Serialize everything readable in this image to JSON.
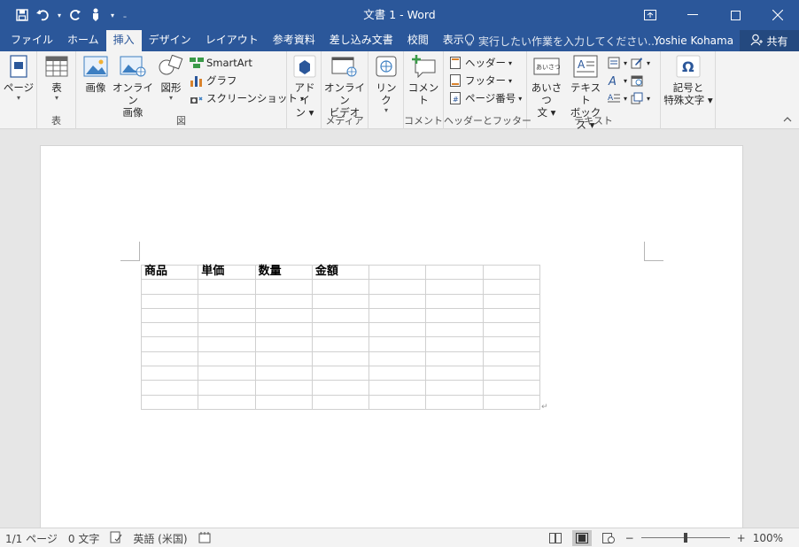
{
  "titlebar": {
    "title": "文書 1 - Word",
    "qat": [
      {
        "name": "save-icon"
      },
      {
        "name": "undo-icon"
      },
      {
        "name": "redo-icon"
      },
      {
        "name": "touch-mode-icon"
      }
    ]
  },
  "tabs": [
    "ファイル",
    "ホーム",
    "挿入",
    "デザイン",
    "レイアウト",
    "参考資料",
    "差し込み文書",
    "校閲",
    "表示"
  ],
  "active_tab": "挿入",
  "tellme": "実行したい作業を入力してください...",
  "user": "Yoshie Kohama",
  "share": "共有",
  "ribbon": {
    "groups": {
      "table": "表",
      "illustrations": "図",
      "media": "メディア",
      "comments": "コメント",
      "header_footer": "ヘッダーとフッター",
      "text": "テキスト"
    },
    "page": "ページ",
    "table": "表",
    "picture": "画像",
    "online_picture": [
      "オンライン",
      "画像"
    ],
    "shapes": "図形",
    "smartart": "SmartArt",
    "chart": "グラフ",
    "screenshot": "スクリーンショット",
    "addin": [
      "アドイ",
      "ン"
    ],
    "online_video": [
      "オンライン",
      "ビデオ"
    ],
    "link": "リンク",
    "comment": "コメント",
    "header": "ヘッダー",
    "footer": "フッター",
    "page_number": "ページ番号",
    "greeting": [
      "あいさつ",
      "文"
    ],
    "greeting_icon_text": "あいさつ",
    "textbox": [
      "テキスト",
      "ボックス"
    ],
    "symbols": [
      "記号と",
      "特殊文字"
    ]
  },
  "table": {
    "rows": [
      [
        "商品",
        "単価",
        "数量",
        "金額",
        "",
        "",
        ""
      ],
      [
        "",
        "",
        "",
        "",
        "",
        "",
        ""
      ],
      [
        "",
        "",
        "",
        "",
        "",
        "",
        ""
      ],
      [
        "",
        "",
        "",
        "",
        "",
        "",
        ""
      ],
      [
        "",
        "",
        "",
        "",
        "",
        "",
        ""
      ],
      [
        "",
        "",
        "",
        "",
        "",
        "",
        ""
      ],
      [
        "",
        "",
        "",
        "",
        "",
        "",
        ""
      ],
      [
        "",
        "",
        "",
        "",
        "",
        "",
        ""
      ],
      [
        "",
        "",
        "",
        "",
        "",
        "",
        ""
      ],
      [
        "",
        "",
        "",
        "",
        "",
        "",
        ""
      ]
    ]
  },
  "status": {
    "page": "1/1 ページ",
    "words": "0 文字",
    "language": "英語 (米国)",
    "zoom": "100%",
    "zoom_level": 1.0
  },
  "colors": {
    "brand": "#2b579a",
    "ribbon_bg": "#f3f3f3",
    "canvas_bg": "#e6e6e6"
  }
}
